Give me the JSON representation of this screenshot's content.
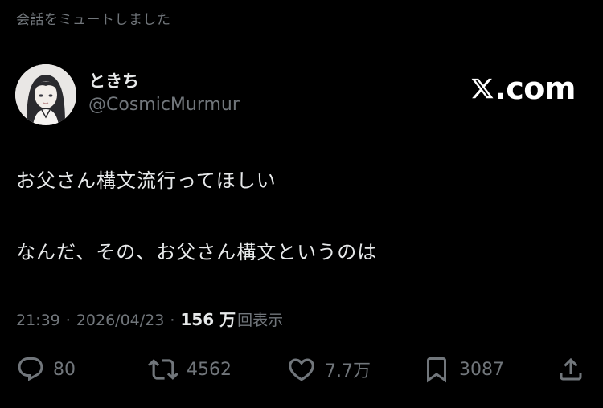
{
  "muted_notice": "会話をミュートしました",
  "author": {
    "display_name": "ときち",
    "handle": "@CosmicMurmur",
    "avatar_icon": "user-avatar"
  },
  "brand": {
    "text": ".com",
    "logo_icon": "x-logo-icon"
  },
  "tweet": {
    "lines": [
      "お父さん構文流行ってほしい",
      "なんだ、その、お父さん構文というのは"
    ]
  },
  "meta": {
    "time": "21:39",
    "separator": "·",
    "date": "2026/04/23",
    "views_count": "156 万",
    "views_label": "回表示"
  },
  "actions": {
    "reply": {
      "icon": "reply-icon",
      "count": "80"
    },
    "repost": {
      "icon": "repost-icon",
      "count": "4562"
    },
    "like": {
      "icon": "heart-icon",
      "count": "7.7万"
    },
    "bookmark": {
      "icon": "bookmark-icon",
      "count": "3087"
    },
    "share": {
      "icon": "share-icon"
    }
  },
  "colors": {
    "background": "#000000",
    "primary_text": "#e7e9ea",
    "secondary_text": "#71767b"
  }
}
